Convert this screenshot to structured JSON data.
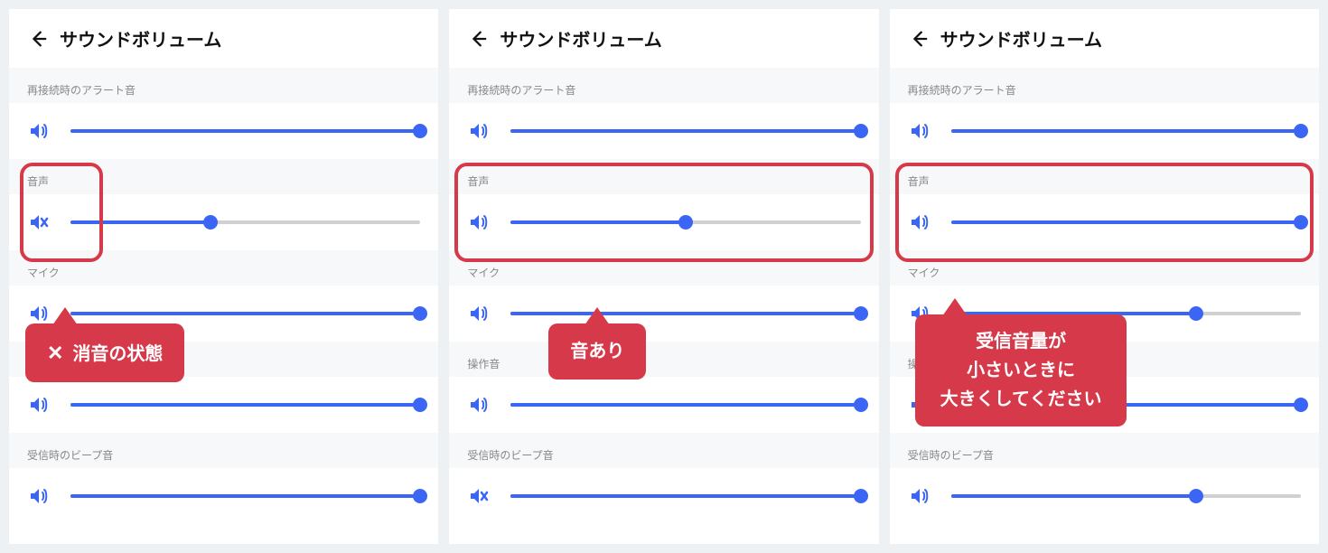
{
  "colors": {
    "accent": "#3b66f5",
    "danger": "#d6394a"
  },
  "labels": {
    "page_title": "サウンドボリューム",
    "reconnect_alert": "再接続時のアラート音",
    "voice": "音声",
    "mic": "マイク",
    "operation_sound": "操作音",
    "receive_beep": "受信時のビープ音"
  },
  "panels": [
    {
      "sliders": {
        "reconnect_alert": {
          "value": 100,
          "muted": false
        },
        "voice": {
          "value": 40,
          "muted": true
        },
        "mic": {
          "value": 100,
          "muted": false
        },
        "operation_sound": {
          "value": 100,
          "muted": false
        },
        "receive_beep": {
          "value": 100,
          "muted": false
        }
      },
      "highlight": {
        "target": "voice-icon-area"
      },
      "callout": {
        "icon": "x",
        "lines": [
          "消音の状態"
        ]
      }
    },
    {
      "sliders": {
        "reconnect_alert": {
          "value": 100,
          "muted": false
        },
        "voice": {
          "value": 50,
          "muted": false
        },
        "mic": {
          "value": 100,
          "muted": false
        },
        "operation_sound": {
          "value": 100,
          "muted": false
        },
        "receive_beep": {
          "value": 100,
          "muted": true
        }
      },
      "highlight": {
        "target": "voice-row"
      },
      "callout": {
        "lines": [
          "音あり"
        ]
      }
    },
    {
      "sliders": {
        "reconnect_alert": {
          "value": 100,
          "muted": false
        },
        "voice": {
          "value": 100,
          "muted": false
        },
        "mic": {
          "value": 70,
          "muted": false
        },
        "operation_sound": {
          "value": 100,
          "muted": false
        },
        "receive_beep": {
          "value": 70,
          "muted": false
        }
      },
      "highlight": {
        "target": "voice-row"
      },
      "callout": {
        "lines": [
          "受信音量が",
          "小さいときに",
          "大きくしてください"
        ]
      }
    }
  ]
}
